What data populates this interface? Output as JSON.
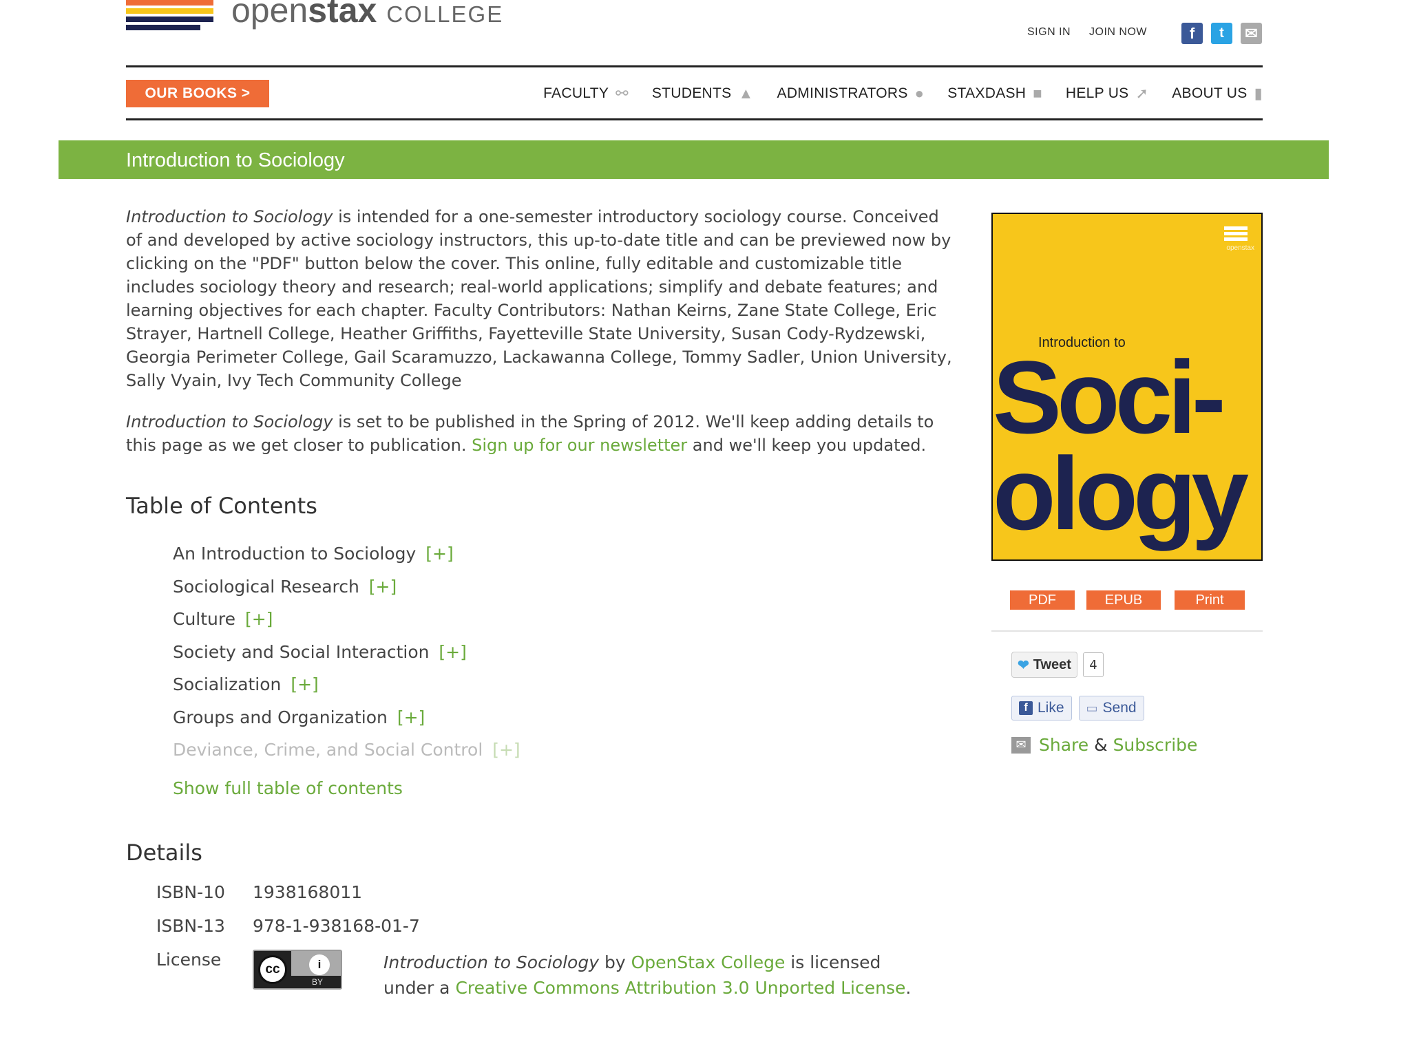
{
  "header": {
    "logo": {
      "word1": "open",
      "word2": "stax",
      "word3": "COLLEGE"
    },
    "links": {
      "sign_in": "SIGN IN",
      "join_now": "JOIN NOW"
    },
    "social": {
      "facebook": "f",
      "twitter": "t",
      "email": "✉"
    }
  },
  "nav": {
    "our_books": "OUR BOOKS  >",
    "items": [
      {
        "label": "FACULTY",
        "icon": "glasses-icon"
      },
      {
        "label": "STUDENTS",
        "icon": "graduation-cap-icon"
      },
      {
        "label": "ADMINISTRATORS",
        "icon": "person-icon"
      },
      {
        "label": "STAXDASH",
        "icon": "folder-icon"
      },
      {
        "label": "HELP US",
        "icon": "cursor-icon"
      },
      {
        "label": "ABOUT US",
        "icon": "building-icon"
      }
    ]
  },
  "page": {
    "title": "Introduction to Sociology"
  },
  "intro": {
    "p1_title": "Introduction to Sociology",
    "p1_text": " is intended for a one-semester introductory sociology course. Conceived of and developed by active sociology instructors, this up-to-date title and can be previewed now by clicking on the \"PDF\" button below the cover. This online, fully editable and customizable title includes sociology theory and research; real-world applications; simplify and debate features; and learning objectives for each chapter. Faculty Contributors: Nathan Keirns, Zane State College, Eric Strayer, Hartnell College, Heather Griffiths, Fayetteville State University, Susan Cody-Rydzewski, Georgia Perimeter College, Gail Scaramuzzo, Lackawanna College, Tommy Sadler, Union University, Sally Vyain, Ivy Tech Community College",
    "p2_title": "Introduction to Sociology",
    "p2_text": " is set to be published in the Spring of 2012. We'll keep adding details to this page as we get closer to publication. ",
    "p2_link": "Sign up for our newsletter",
    "p2_end": " and we'll keep you updated."
  },
  "toc": {
    "title": "Table of Contents",
    "expand": "[+]",
    "items": [
      "An Introduction to Sociology",
      "Sociological Research",
      "Culture",
      "Society and Social Interaction",
      "Socialization",
      "Groups and Organization",
      "Deviance, Crime, and Social Control"
    ],
    "show_full": "Show full table of contents"
  },
  "details": {
    "title": "Details",
    "isbn10_label": "ISBN-10",
    "isbn10": "1938168011",
    "isbn13_label": "ISBN-13",
    "isbn13": "978-1-938168-01-7",
    "license_label": "License",
    "cc_badge": {
      "cc": "cc",
      "attr": "i",
      "by": "BY"
    },
    "license_title": "Introduction to Sociology",
    "license_by": " by ",
    "license_org": "OpenStax College",
    "license_mid": " is licensed under a ",
    "license_link": "Creative Commons Attribution 3.0 Unported License",
    "license_end": "."
  },
  "cover": {
    "intro": "Introduction to",
    "line1": "Soci-",
    "line2": "ology",
    "mini_logo_text": "openstax"
  },
  "downloads": [
    "PDF",
    "EPUB",
    "Print"
  ],
  "social_share": {
    "tweet_label": "Tweet",
    "tweet_count": "4",
    "like_label": "Like",
    "send_label": "Send",
    "share": "Share",
    "amp": "&",
    "subscribe": "Subscribe"
  },
  "colors": {
    "accent_orange": "#ef6c37",
    "title_green": "#7cb342",
    "link_green": "#6aaa3b",
    "cover_yellow": "#f7c61b",
    "cover_navy": "#1d2350",
    "logo_stripes": [
      "#ef6c37",
      "#f7c61b",
      "#1d2350"
    ]
  }
}
